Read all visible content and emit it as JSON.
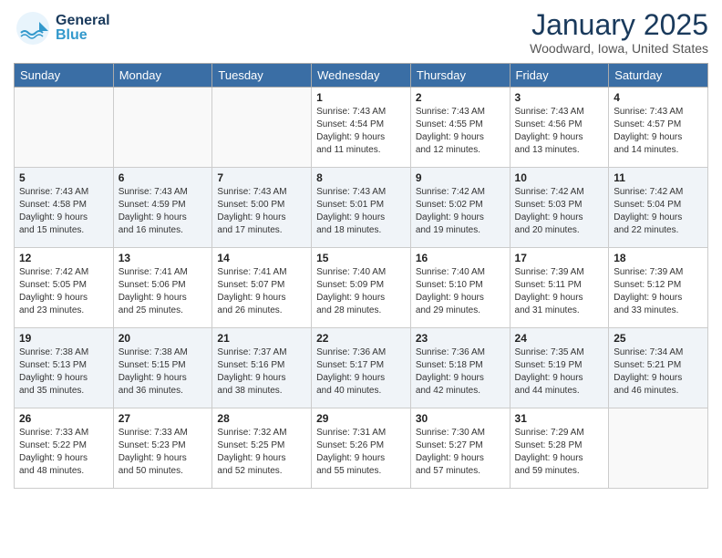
{
  "header": {
    "logo_general": "General",
    "logo_blue": "Blue",
    "month_title": "January 2025",
    "location": "Woodward, Iowa, United States"
  },
  "weekdays": [
    "Sunday",
    "Monday",
    "Tuesday",
    "Wednesday",
    "Thursday",
    "Friday",
    "Saturday"
  ],
  "weeks": [
    [
      {
        "day": "",
        "info": ""
      },
      {
        "day": "",
        "info": ""
      },
      {
        "day": "",
        "info": ""
      },
      {
        "day": "1",
        "info": "Sunrise: 7:43 AM\nSunset: 4:54 PM\nDaylight: 9 hours\nand 11 minutes."
      },
      {
        "day": "2",
        "info": "Sunrise: 7:43 AM\nSunset: 4:55 PM\nDaylight: 9 hours\nand 12 minutes."
      },
      {
        "day": "3",
        "info": "Sunrise: 7:43 AM\nSunset: 4:56 PM\nDaylight: 9 hours\nand 13 minutes."
      },
      {
        "day": "4",
        "info": "Sunrise: 7:43 AM\nSunset: 4:57 PM\nDaylight: 9 hours\nand 14 minutes."
      }
    ],
    [
      {
        "day": "5",
        "info": "Sunrise: 7:43 AM\nSunset: 4:58 PM\nDaylight: 9 hours\nand 15 minutes."
      },
      {
        "day": "6",
        "info": "Sunrise: 7:43 AM\nSunset: 4:59 PM\nDaylight: 9 hours\nand 16 minutes."
      },
      {
        "day": "7",
        "info": "Sunrise: 7:43 AM\nSunset: 5:00 PM\nDaylight: 9 hours\nand 17 minutes."
      },
      {
        "day": "8",
        "info": "Sunrise: 7:43 AM\nSunset: 5:01 PM\nDaylight: 9 hours\nand 18 minutes."
      },
      {
        "day": "9",
        "info": "Sunrise: 7:42 AM\nSunset: 5:02 PM\nDaylight: 9 hours\nand 19 minutes."
      },
      {
        "day": "10",
        "info": "Sunrise: 7:42 AM\nSunset: 5:03 PM\nDaylight: 9 hours\nand 20 minutes."
      },
      {
        "day": "11",
        "info": "Sunrise: 7:42 AM\nSunset: 5:04 PM\nDaylight: 9 hours\nand 22 minutes."
      }
    ],
    [
      {
        "day": "12",
        "info": "Sunrise: 7:42 AM\nSunset: 5:05 PM\nDaylight: 9 hours\nand 23 minutes."
      },
      {
        "day": "13",
        "info": "Sunrise: 7:41 AM\nSunset: 5:06 PM\nDaylight: 9 hours\nand 25 minutes."
      },
      {
        "day": "14",
        "info": "Sunrise: 7:41 AM\nSunset: 5:07 PM\nDaylight: 9 hours\nand 26 minutes."
      },
      {
        "day": "15",
        "info": "Sunrise: 7:40 AM\nSunset: 5:09 PM\nDaylight: 9 hours\nand 28 minutes."
      },
      {
        "day": "16",
        "info": "Sunrise: 7:40 AM\nSunset: 5:10 PM\nDaylight: 9 hours\nand 29 minutes."
      },
      {
        "day": "17",
        "info": "Sunrise: 7:39 AM\nSunset: 5:11 PM\nDaylight: 9 hours\nand 31 minutes."
      },
      {
        "day": "18",
        "info": "Sunrise: 7:39 AM\nSunset: 5:12 PM\nDaylight: 9 hours\nand 33 minutes."
      }
    ],
    [
      {
        "day": "19",
        "info": "Sunrise: 7:38 AM\nSunset: 5:13 PM\nDaylight: 9 hours\nand 35 minutes."
      },
      {
        "day": "20",
        "info": "Sunrise: 7:38 AM\nSunset: 5:15 PM\nDaylight: 9 hours\nand 36 minutes."
      },
      {
        "day": "21",
        "info": "Sunrise: 7:37 AM\nSunset: 5:16 PM\nDaylight: 9 hours\nand 38 minutes."
      },
      {
        "day": "22",
        "info": "Sunrise: 7:36 AM\nSunset: 5:17 PM\nDaylight: 9 hours\nand 40 minutes."
      },
      {
        "day": "23",
        "info": "Sunrise: 7:36 AM\nSunset: 5:18 PM\nDaylight: 9 hours\nand 42 minutes."
      },
      {
        "day": "24",
        "info": "Sunrise: 7:35 AM\nSunset: 5:19 PM\nDaylight: 9 hours\nand 44 minutes."
      },
      {
        "day": "25",
        "info": "Sunrise: 7:34 AM\nSunset: 5:21 PM\nDaylight: 9 hours\nand 46 minutes."
      }
    ],
    [
      {
        "day": "26",
        "info": "Sunrise: 7:33 AM\nSunset: 5:22 PM\nDaylight: 9 hours\nand 48 minutes."
      },
      {
        "day": "27",
        "info": "Sunrise: 7:33 AM\nSunset: 5:23 PM\nDaylight: 9 hours\nand 50 minutes."
      },
      {
        "day": "28",
        "info": "Sunrise: 7:32 AM\nSunset: 5:25 PM\nDaylight: 9 hours\nand 52 minutes."
      },
      {
        "day": "29",
        "info": "Sunrise: 7:31 AM\nSunset: 5:26 PM\nDaylight: 9 hours\nand 55 minutes."
      },
      {
        "day": "30",
        "info": "Sunrise: 7:30 AM\nSunset: 5:27 PM\nDaylight: 9 hours\nand 57 minutes."
      },
      {
        "day": "31",
        "info": "Sunrise: 7:29 AM\nSunset: 5:28 PM\nDaylight: 9 hours\nand 59 minutes."
      },
      {
        "day": "",
        "info": ""
      }
    ]
  ]
}
